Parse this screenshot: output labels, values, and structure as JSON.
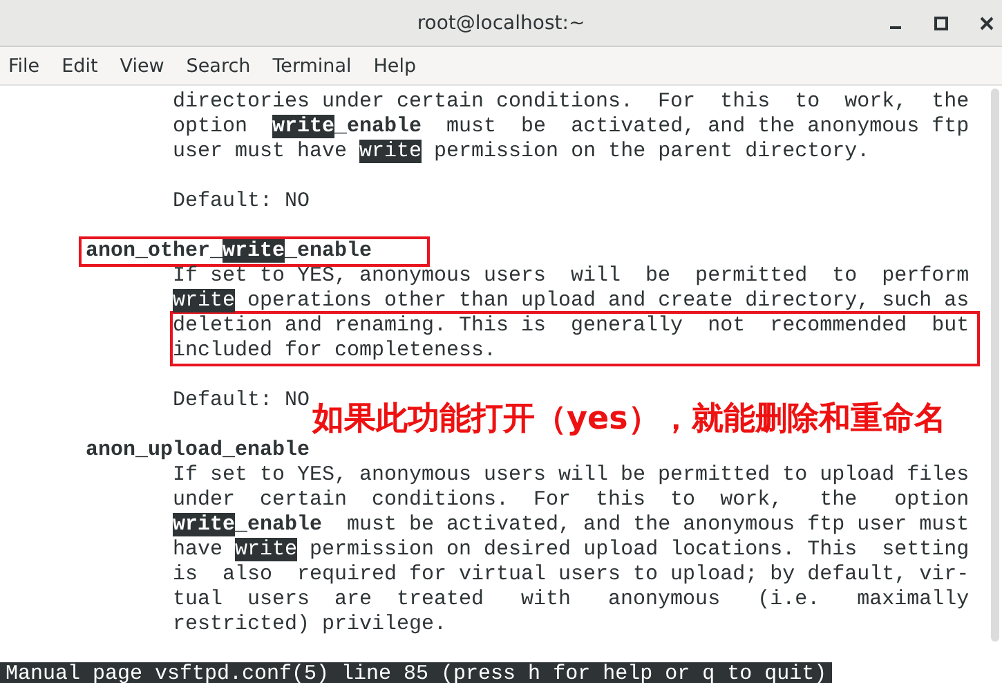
{
  "window": {
    "title": "root@localhost:~"
  },
  "menu": [
    "File",
    "Edit",
    "View",
    "Search",
    "Terminal",
    "Help"
  ],
  "lines": [
    {
      "kind": "body",
      "boxed": false,
      "segments": [
        {
          "kind": "text",
          "text": "directories under certain conditions.  For  this  to  work,  the"
        }
      ]
    },
    {
      "kind": "body",
      "boxed": false,
      "segments": [
        {
          "kind": "text",
          "text": "option  "
        },
        {
          "kind": "reverse-bold",
          "text": "write"
        },
        {
          "kind": "bold",
          "text": "_enable"
        },
        {
          "kind": "text",
          "text": "  must  be  activated, and the anonymous ftp"
        }
      ]
    },
    {
      "kind": "body",
      "boxed": false,
      "segments": [
        {
          "kind": "text",
          "text": "user must have "
        },
        {
          "kind": "reverse",
          "text": "write"
        },
        {
          "kind": "text",
          "text": " permission on the parent directory."
        }
      ]
    },
    {
      "kind": "blank"
    },
    {
      "kind": "body",
      "boxed": false,
      "segments": [
        {
          "kind": "text",
          "text": "Default: NO"
        }
      ]
    },
    {
      "kind": "blank"
    },
    {
      "kind": "heading",
      "boxed": true,
      "segments": [
        {
          "kind": "bold",
          "text": "anon_other_"
        },
        {
          "kind": "reverse-bold",
          "text": "write"
        },
        {
          "kind": "bold",
          "text": "_enable"
        }
      ]
    },
    {
      "kind": "body",
      "boxed": false,
      "segments": [
        {
          "kind": "text",
          "text": "If set to YES, anonymous users  will  be  permitted  to  perform"
        }
      ]
    },
    {
      "kind": "body",
      "boxed": false,
      "segments": [
        {
          "kind": "reverse",
          "text": "write"
        },
        {
          "kind": "text",
          "text": " operations other than upload and create directory, such as"
        }
      ]
    },
    {
      "kind": "body",
      "boxed": true,
      "segments": [
        {
          "kind": "text",
          "text": "deletion and renaming. This is  generally  not  recommended  but"
        }
      ]
    },
    {
      "kind": "body",
      "boxed": true,
      "segments": [
        {
          "kind": "text",
          "text": "included for completeness."
        }
      ]
    },
    {
      "kind": "blank"
    },
    {
      "kind": "body",
      "boxed": false,
      "segments": [
        {
          "kind": "text",
          "text": "Default: NO"
        }
      ]
    },
    {
      "kind": "blank"
    },
    {
      "kind": "heading",
      "boxed": false,
      "segments": [
        {
          "kind": "bold",
          "text": "anon_upload_enable"
        }
      ]
    },
    {
      "kind": "body",
      "boxed": false,
      "segments": [
        {
          "kind": "text",
          "text": "If set to YES, anonymous users will be permitted to upload files"
        }
      ]
    },
    {
      "kind": "body",
      "boxed": false,
      "segments": [
        {
          "kind": "text",
          "text": "under  certain  conditions.  For  this  to  work,   the   option"
        }
      ]
    },
    {
      "kind": "body",
      "boxed": false,
      "segments": [
        {
          "kind": "reverse-bold",
          "text": "write"
        },
        {
          "kind": "bold",
          "text": "_enable"
        },
        {
          "kind": "text",
          "text": "  must be activated, and the anonymous ftp user must"
        }
      ]
    },
    {
      "kind": "body",
      "boxed": false,
      "segments": [
        {
          "kind": "text",
          "text": "have "
        },
        {
          "kind": "reverse",
          "text": "write"
        },
        {
          "kind": "text",
          "text": " permission on desired upload locations. This  setting"
        }
      ]
    },
    {
      "kind": "body",
      "boxed": false,
      "segments": [
        {
          "kind": "text",
          "text": "is  also  required for virtual users to upload; by default, vir-"
        }
      ]
    },
    {
      "kind": "body",
      "boxed": false,
      "segments": [
        {
          "kind": "text",
          "text": "tual  users  are  treated   with   anonymous   (i.e.   maximally"
        }
      ]
    },
    {
      "kind": "body",
      "boxed": false,
      "segments": [
        {
          "kind": "text",
          "text": "restricted) privilege."
        }
      ]
    },
    {
      "kind": "blank"
    }
  ],
  "annotation": {
    "caption": "如果此功能打开（yes），就能删除和重命名"
  },
  "status_bar": "Manual page vsftpd.conf(5) line 85 (press h for help or q to quit)"
}
